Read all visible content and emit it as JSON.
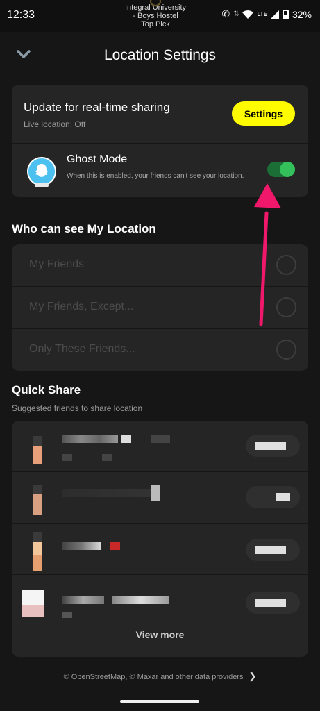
{
  "status_bar": {
    "time": "12:33",
    "map_label_line1": "Integral University",
    "map_label_line2": "- Boys Hostel",
    "map_label_line3": "Top Pick",
    "network": "LTE",
    "battery": "32%"
  },
  "header": {
    "title": "Location Settings",
    "back_icon": "chevron-down-icon"
  },
  "sharing": {
    "title": "Update for real-time sharing",
    "subtitle": "Live location: Off",
    "settings_label": "Settings",
    "accent": "#fffc00"
  },
  "ghost_mode": {
    "title": "Ghost Mode",
    "description": "When this is enabled, your friends can't see your location.",
    "enabled": true,
    "toggle_color": "#34c05a"
  },
  "visibility": {
    "heading": "Who can see My Location",
    "options": [
      {
        "label": "My Friends"
      },
      {
        "label": "My Friends, Except..."
      },
      {
        "label": "Only These Friends..."
      }
    ]
  },
  "quick_share": {
    "heading": "Quick Share",
    "subtitle": "Suggested friends to share location",
    "view_more": "View more"
  },
  "footer": {
    "attribution": "© OpenStreetMap, © Maxar and other data providers"
  }
}
